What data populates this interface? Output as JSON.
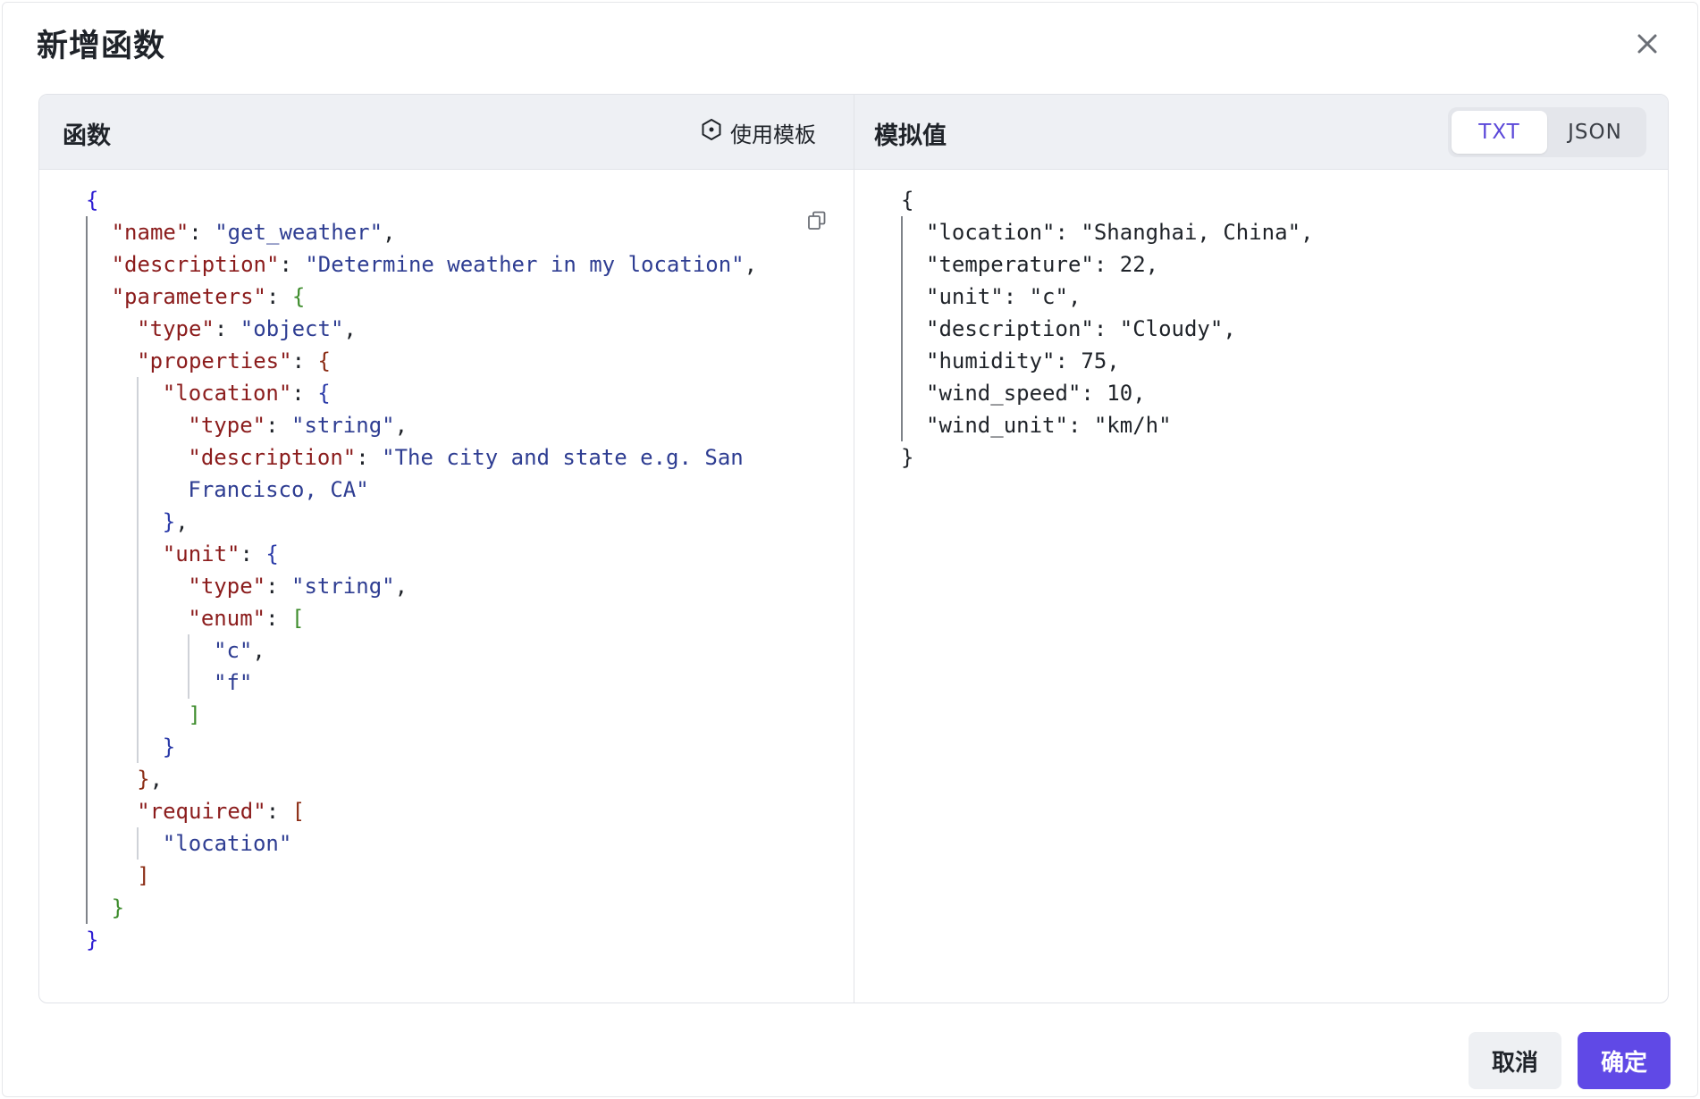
{
  "dialog": {
    "title": "新增函数",
    "close_icon": "close-icon"
  },
  "left": {
    "title": "函数",
    "template_label": "使用模板",
    "template_icon": "template-icon",
    "copy_icon": "copy-icon"
  },
  "right": {
    "title": "模拟值",
    "tabs": [
      {
        "label": "TXT",
        "active": true
      },
      {
        "label": "JSON",
        "active": false
      }
    ]
  },
  "function_code": [
    {
      "tokens": [
        [
          "b1",
          "{"
        ]
      ]
    },
    {
      "tokens": [
        [
          "k",
          "\"name\""
        ],
        [
          "p",
          ": "
        ],
        [
          "s",
          "\"get_weather\""
        ],
        [
          "p",
          ","
        ]
      ]
    },
    {
      "tokens": [
        [
          "k",
          "\"description\""
        ],
        [
          "p",
          ": "
        ],
        [
          "s",
          "\"Determine weather in my location\""
        ],
        [
          "p",
          ","
        ]
      ]
    },
    {
      "tokens": [
        [
          "k",
          "\"parameters\""
        ],
        [
          "p",
          ": "
        ],
        [
          "b2",
          "{"
        ]
      ]
    },
    {
      "tokens": [
        [
          "k",
          "\"type\""
        ],
        [
          "p",
          ": "
        ],
        [
          "s",
          "\"object\""
        ],
        [
          "p",
          ","
        ]
      ]
    },
    {
      "tokens": [
        [
          "k",
          "\"properties\""
        ],
        [
          "p",
          ": "
        ],
        [
          "b3",
          "{"
        ]
      ]
    },
    {
      "tokens": [
        [
          "k",
          "\"location\""
        ],
        [
          "p",
          ": "
        ],
        [
          "b4",
          "{"
        ]
      ]
    },
    {
      "tokens": [
        [
          "k",
          "\"type\""
        ],
        [
          "p",
          ": "
        ],
        [
          "s",
          "\"string\""
        ],
        [
          "p",
          ","
        ]
      ]
    },
    {
      "tokens": [
        [
          "k",
          "\"description\""
        ],
        [
          "p",
          ": "
        ],
        [
          "s",
          "\"The city and state e.g. San"
        ]
      ]
    },
    {
      "tokens": [
        [
          "s",
          "Francisco, CA\""
        ]
      ]
    },
    {
      "tokens": [
        [
          "b4",
          "}"
        ],
        [
          "p",
          ","
        ]
      ]
    },
    {
      "tokens": [
        [
          "k",
          "\"unit\""
        ],
        [
          "p",
          ": "
        ],
        [
          "b4",
          "{"
        ]
      ]
    },
    {
      "tokens": [
        [
          "k",
          "\"type\""
        ],
        [
          "p",
          ": "
        ],
        [
          "s",
          "\"string\""
        ],
        [
          "p",
          ","
        ]
      ]
    },
    {
      "tokens": [
        [
          "k",
          "\"enum\""
        ],
        [
          "p",
          ": "
        ],
        [
          "b2",
          "["
        ]
      ]
    },
    {
      "tokens": [
        [
          "s",
          "\"c\""
        ],
        [
          "p",
          ","
        ]
      ]
    },
    {
      "tokens": [
        [
          "s",
          "\"f\""
        ]
      ]
    },
    {
      "tokens": [
        [
          "b2",
          "]"
        ]
      ]
    },
    {
      "tokens": [
        [
          "b4",
          "}"
        ]
      ]
    },
    {
      "tokens": [
        [
          "b3",
          "}"
        ],
        [
          "p",
          ","
        ]
      ]
    },
    {
      "tokens": [
        [
          "k",
          "\"required\""
        ],
        [
          "p",
          ": "
        ],
        [
          "b3",
          "["
        ]
      ]
    },
    {
      "tokens": [
        [
          "s",
          "\"location\""
        ]
      ]
    },
    {
      "tokens": [
        [
          "b3",
          "]"
        ]
      ]
    },
    {
      "tokens": [
        [
          "b2",
          "}"
        ]
      ]
    },
    {
      "tokens": [
        [
          "b1",
          "}"
        ]
      ]
    }
  ],
  "mock_code": [
    "{",
    "\"location\": \"Shanghai, China\",",
    "\"temperature\": 22,",
    "\"unit\": \"c\",",
    "\"description\": \"Cloudy\",",
    "\"humidity\": 75,",
    "\"wind_speed\": 10,",
    "\"wind_unit\": \"km/h\"",
    "}"
  ],
  "footer": {
    "cancel_label": "取消",
    "ok_label": "确定"
  }
}
